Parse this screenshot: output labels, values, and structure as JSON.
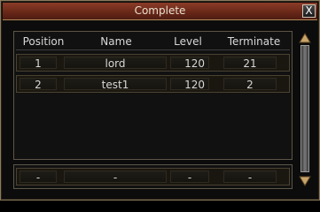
{
  "window": {
    "title": "Complete",
    "close_label": "X"
  },
  "table": {
    "columns": [
      "Position",
      "Name",
      "Level",
      "Terminate"
    ],
    "rows": [
      {
        "position": "1",
        "name": "lord",
        "level": "120",
        "terminate": "21"
      },
      {
        "position": "2",
        "name": "test1",
        "level": "120",
        "terminate": "2"
      }
    ],
    "footer": {
      "position": "-",
      "name": "-",
      "level": "-",
      "terminate": "-"
    }
  }
}
